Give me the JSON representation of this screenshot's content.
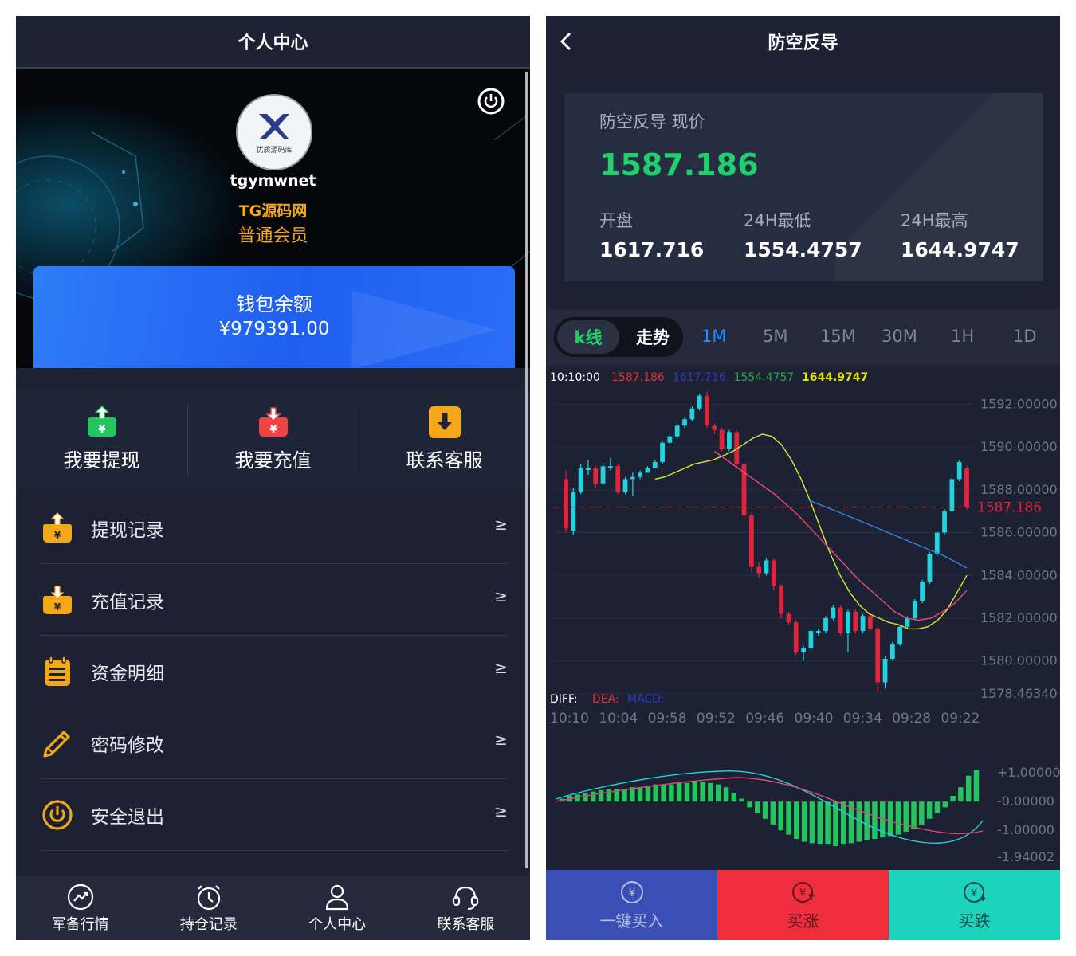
{
  "left": {
    "header_title": "个人中心",
    "user": {
      "avatar_caption": "优质源码库",
      "username": "tgymwnet",
      "brand": "TG源码网",
      "level": "普通会员"
    },
    "wallet": {
      "title": "钱包余额",
      "amount": "¥979391.00"
    },
    "quick_actions": [
      {
        "label": "我要提现",
        "icon": "withdraw-icon",
        "color": "#22c55e"
      },
      {
        "label": "我要充值",
        "icon": "recharge-icon",
        "color": "#ef4444"
      },
      {
        "label": "联系客服",
        "icon": "download-icon",
        "color": "#f4a718"
      }
    ],
    "menu": [
      {
        "label": "提现记录",
        "icon": "withdraw-record-icon",
        "arrow": "≥"
      },
      {
        "label": "充值记录",
        "icon": "recharge-record-icon",
        "arrow": "≥"
      },
      {
        "label": "资金明细",
        "icon": "clipboard-icon",
        "arrow": "≥"
      },
      {
        "label": "密码修改",
        "icon": "pencil-icon",
        "arrow": "≥"
      },
      {
        "label": "安全退出",
        "icon": "power-icon",
        "arrow": "≥"
      }
    ],
    "bottom_nav": [
      {
        "label": "军备行情",
        "icon": "trend-icon"
      },
      {
        "label": "持仓记录",
        "icon": "clock-icon"
      },
      {
        "label": "个人中心",
        "icon": "user-icon"
      },
      {
        "label": "联系客服",
        "icon": "headset-icon"
      }
    ]
  },
  "right": {
    "header_title": "防空反导",
    "price_card": {
      "name_label": "防空反导 现价",
      "price": "1587.186",
      "open_label": "开盘",
      "open_value": "1617.716",
      "low_label": "24H最低",
      "low_value": "1554.4757",
      "high_label": "24H最高",
      "high_value": "1644.9747"
    },
    "chart_toggle": {
      "kline": "k线",
      "trend": "走势"
    },
    "timeframes": [
      "1M",
      "5M",
      "15M",
      "30M",
      "1H",
      "1D"
    ],
    "active_timeframe": "1M",
    "trade_buttons": [
      {
        "label": "一键买入",
        "icon": "yen-icon",
        "bg": "#3a4fb5",
        "fg": "#b8c0e6"
      },
      {
        "label": "买涨",
        "icon": "yen-up-icon",
        "bg": "#f02d3c",
        "fg": "#5a1a1e"
      },
      {
        "label": "买跌",
        "icon": "yen-down-icon",
        "bg": "#1ed3bd",
        "fg": "#0d4e47"
      }
    ]
  },
  "chart_data": {
    "type": "candlestick",
    "info_time": "10:10:00",
    "info_values": [
      {
        "text": "1587.186",
        "color": "#e0312f"
      },
      {
        "text": "1617.716",
        "color": "#2c3cbf"
      },
      {
        "text": "1554.4757",
        "color": "#27a844"
      },
      {
        "text": "1644.9747",
        "color": "#e6e600"
      }
    ],
    "y_ticks": [
      "1592.00000",
      "1590.00000",
      "1588.00000",
      "1586.00000",
      "1584.00000",
      "1582.00000",
      "1580.00000",
      "1578.46340"
    ],
    "current_price_label": "1587.186",
    "x_ticks": [
      "10:10",
      "10:04",
      "09:58",
      "09:52",
      "09:46",
      "09:40",
      "09:34",
      "09:28",
      "09:22"
    ],
    "macd_labels": [
      {
        "text": "DIFF:",
        "color": "#ffffff"
      },
      {
        "text": "DEA:",
        "color": "#e0312f"
      },
      {
        "text": "MACD:",
        "color": "#2c3cbf"
      }
    ],
    "macd_ticks": [
      "+1.00000",
      "-0.00000",
      "-1.00000",
      "-1.94002"
    ],
    "colors": {
      "up": "#1fd3e0",
      "down": "#e0243c",
      "ma1": "#d7e83a",
      "ma2": "#f0477a",
      "ma3": "#3a7fe0",
      "ma4": "#8890a0",
      "macd_bar": "#22c55e",
      "diff": "#1fd3e0",
      "dea": "#e0477a"
    },
    "candles": [
      [
        1588.5,
        1586.2,
        1588.9,
        1586.0
      ],
      [
        1586.1,
        1587.9,
        1588.1,
        1585.9
      ],
      [
        1587.9,
        1589.0,
        1589.2,
        1587.8
      ],
      [
        1589.0,
        1589.0,
        1589.4,
        1588.7
      ],
      [
        1589.0,
        1588.3,
        1589.1,
        1588.1
      ],
      [
        1588.3,
        1589.1,
        1589.3,
        1588.2
      ],
      [
        1589.1,
        1589.1,
        1589.5,
        1588.9
      ],
      [
        1589.1,
        1587.9,
        1589.2,
        1587.8
      ],
      [
        1587.9,
        1588.5,
        1588.6,
        1587.8
      ],
      [
        1588.5,
        1588.6,
        1588.8,
        1587.7
      ],
      [
        1588.6,
        1588.8,
        1588.9,
        1588.5
      ],
      [
        1588.8,
        1589.0,
        1589.1,
        1588.8
      ],
      [
        1589.0,
        1589.3,
        1589.4,
        1589.0
      ],
      [
        1589.3,
        1590.2,
        1590.3,
        1589.2
      ],
      [
        1590.2,
        1590.5,
        1590.6,
        1590.1
      ],
      [
        1590.5,
        1591.0,
        1591.1,
        1590.4
      ],
      [
        1591.0,
        1591.3,
        1591.4,
        1590.9
      ],
      [
        1591.3,
        1591.8,
        1591.9,
        1591.2
      ],
      [
        1591.8,
        1592.4,
        1592.5,
        1591.7
      ],
      [
        1592.4,
        1591.0,
        1592.6,
        1590.9
      ],
      [
        1591.0,
        1590.8,
        1591.1,
        1590.6
      ],
      [
        1590.8,
        1589.9,
        1590.9,
        1589.8
      ],
      [
        1589.9,
        1590.7,
        1590.8,
        1589.8
      ],
      [
        1590.7,
        1589.2,
        1590.8,
        1589.0
      ],
      [
        1589.2,
        1586.8,
        1589.3,
        1586.6
      ],
      [
        1586.8,
        1584.4,
        1586.9,
        1584.2
      ],
      [
        1584.4,
        1584.1,
        1584.6,
        1583.9
      ],
      [
        1584.1,
        1584.7,
        1584.8,
        1584.0
      ],
      [
        1584.7,
        1583.5,
        1584.8,
        1583.3
      ],
      [
        1583.5,
        1582.2,
        1583.6,
        1582.0
      ],
      [
        1582.2,
        1581.8,
        1582.3,
        1581.7
      ],
      [
        1581.8,
        1580.4,
        1581.9,
        1580.3
      ],
      [
        1580.4,
        1580.6,
        1580.7,
        1580.0
      ],
      [
        1580.6,
        1581.4,
        1581.5,
        1580.5
      ],
      [
        1581.4,
        1581.4,
        1581.5,
        1581.2
      ],
      [
        1581.4,
        1582.0,
        1582.1,
        1581.3
      ],
      [
        1582.0,
        1582.5,
        1582.6,
        1581.9
      ],
      [
        1582.5,
        1581.3,
        1582.6,
        1581.2
      ],
      [
        1581.3,
        1582.3,
        1582.4,
        1580.4
      ],
      [
        1582.3,
        1581.4,
        1582.4,
        1581.3
      ],
      [
        1581.4,
        1582.1,
        1582.2,
        1581.3
      ],
      [
        1582.1,
        1581.5,
        1582.2,
        1581.4
      ],
      [
        1581.5,
        1579.0,
        1581.6,
        1578.5
      ],
      [
        1579.0,
        1580.1,
        1580.2,
        1578.7
      ],
      [
        1580.1,
        1580.8,
        1580.9,
        1580.0
      ],
      [
        1580.8,
        1581.6,
        1581.7,
        1580.7
      ],
      [
        1581.6,
        1582.0,
        1582.1,
        1581.5
      ],
      [
        1582.0,
        1582.8,
        1582.9,
        1581.9
      ],
      [
        1582.8,
        1583.7,
        1583.8,
        1582.7
      ],
      [
        1583.7,
        1585.0,
        1585.1,
        1583.6
      ],
      [
        1585.0,
        1586.0,
        1586.1,
        1584.9
      ],
      [
        1586.0,
        1587.0,
        1587.1,
        1585.9
      ],
      [
        1587.0,
        1588.5,
        1588.6,
        1586.9
      ],
      [
        1588.5,
        1589.3,
        1589.4,
        1588.4
      ],
      [
        1589.0,
        1587.2,
        1589.1,
        1587.1
      ]
    ],
    "ma_lines": [
      [
        1588.5,
        1588.6,
        1588.8,
        1589.0,
        1589.2,
        1589.3,
        1589.4,
        1589.6,
        1589.8,
        1590.1,
        1590.4,
        1590.6,
        1590.5,
        1590.1,
        1589.4,
        1588.5,
        1587.4,
        1586.2,
        1585.0,
        1584.0,
        1583.2,
        1582.6,
        1582.2,
        1582.0,
        1581.8,
        1581.7,
        1581.5,
        1581.5,
        1581.6,
        1581.9,
        1582.4,
        1583.2,
        1584.0
      ],
      [
        1589.8,
        1589.4,
        1589.0,
        1588.6,
        1588.2,
        1587.8,
        1587.3,
        1586.8,
        1586.2,
        1585.6,
        1585.0,
        1584.4,
        1583.8,
        1583.3,
        1582.8,
        1582.3,
        1582.0,
        1581.9,
        1582.0,
        1582.3,
        1582.7,
        1583.3
      ]
    ],
    "macd_bars": [
      0.1,
      0.2,
      0.25,
      0.3,
      0.35,
      0.4,
      0.45,
      0.45,
      0.45,
      0.5,
      0.5,
      0.55,
      0.6,
      0.6,
      0.6,
      0.65,
      0.65,
      0.7,
      0.7,
      0.65,
      0.6,
      0.5,
      0.3,
      0.1,
      -0.2,
      -0.4,
      -0.6,
      -0.8,
      -1.0,
      -1.15,
      -1.3,
      -1.4,
      -1.45,
      -1.5,
      -1.5,
      -1.55,
      -1.5,
      -1.45,
      -1.4,
      -1.35,
      -1.3,
      -1.25,
      -1.2,
      -1.15,
      -1.05,
      -0.95,
      -0.8,
      -0.6,
      -0.4,
      -0.2,
      0.2,
      0.5,
      0.9,
      1.1
    ]
  }
}
